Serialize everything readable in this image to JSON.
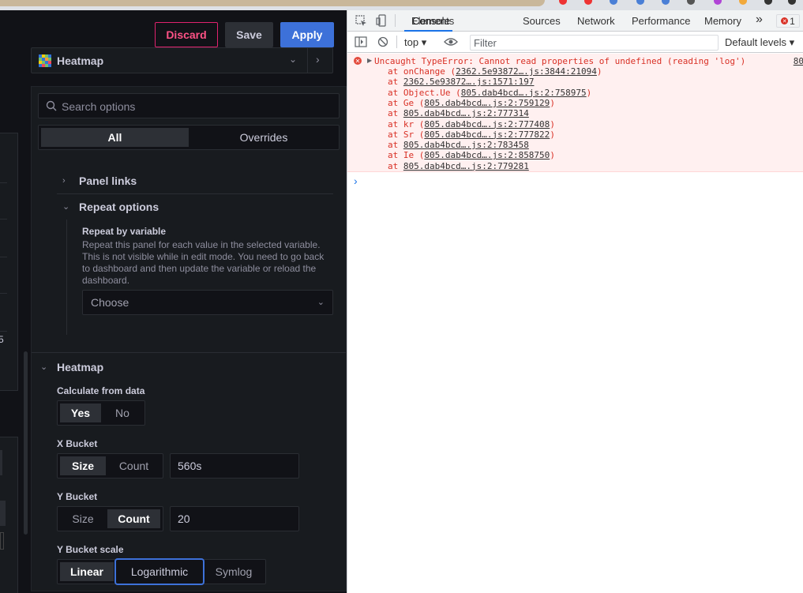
{
  "toolbar": {
    "discard": "Discard",
    "save": "Save",
    "apply": "Apply"
  },
  "viz": {
    "name": "Heatmap",
    "icon": "heatmap-icon"
  },
  "options": {
    "search_placeholder": "Search options",
    "tabs": [
      "All",
      "Overrides"
    ],
    "panel_links": "Panel links",
    "repeat_options": "Repeat options",
    "repeat_by_variable": "Repeat by variable",
    "repeat_desc": "Repeat this panel for each value in the selected variable. This is not visible while in edit mode. You need to go back to dashboard and then update the variable or reload the dashboard.",
    "choose_placeholder": "Choose"
  },
  "heatmap": {
    "title": "Heatmap",
    "calc_label": "Calculate from data",
    "calc_options": [
      "Yes",
      "No"
    ],
    "calc_selected": "Yes",
    "xbucket_label": "X Bucket",
    "xbucket_options": [
      "Size",
      "Count"
    ],
    "xbucket_selected": "Size",
    "xbucket_value": "560s",
    "ybucket_label": "Y Bucket",
    "ybucket_options": [
      "Size",
      "Count"
    ],
    "ybucket_selected": "Count",
    "ybucket_value": "20",
    "yscale_label": "Y Bucket scale",
    "yscale_options": [
      "Linear",
      "Logarithmic",
      "Symlog"
    ],
    "yscale_selected": "Linear",
    "yscale_focused": "Logarithmic"
  },
  "edge_text": "5",
  "devtools": {
    "tabs": [
      "Elements",
      "Console",
      "Sources",
      "Network",
      "Performance",
      "Memory"
    ],
    "active_tab": "Console",
    "more": "»",
    "error_count": "1",
    "context": "top",
    "filter_placeholder": "Filter",
    "levels": "Default levels",
    "error_message": "Uncaught TypeError: Cannot read properties of undefined (reading 'log')",
    "error_source": "80",
    "stack": [
      {
        "fn": "at onChange (",
        "loc": "2362.5e93872….js:3844:21094",
        "end": ")"
      },
      {
        "fn": "at ",
        "loc": "2362.5e93872….js:1571:197",
        "end": ""
      },
      {
        "fn": "at Object.Ue (",
        "loc": "805.dab4bcd….js:2:758975",
        "end": ")"
      },
      {
        "fn": "at Ge (",
        "loc": "805.dab4bcd….js:2:759129",
        "end": ")"
      },
      {
        "fn": "at ",
        "loc": "805.dab4bcd….js:2:777314",
        "end": ""
      },
      {
        "fn": "at kr (",
        "loc": "805.dab4bcd….js:2:777408",
        "end": ")"
      },
      {
        "fn": "at Sr (",
        "loc": "805.dab4bcd….js:2:777822",
        "end": ")"
      },
      {
        "fn": "at ",
        "loc": "805.dab4bcd….js:2:783458",
        "end": ""
      },
      {
        "fn": "at Ie (",
        "loc": "805.dab4bcd….js:2:858750",
        "end": ")"
      },
      {
        "fn": "at ",
        "loc": "805.dab4bcd….js:2:779281",
        "end": ""
      }
    ],
    "prompt": "›"
  }
}
